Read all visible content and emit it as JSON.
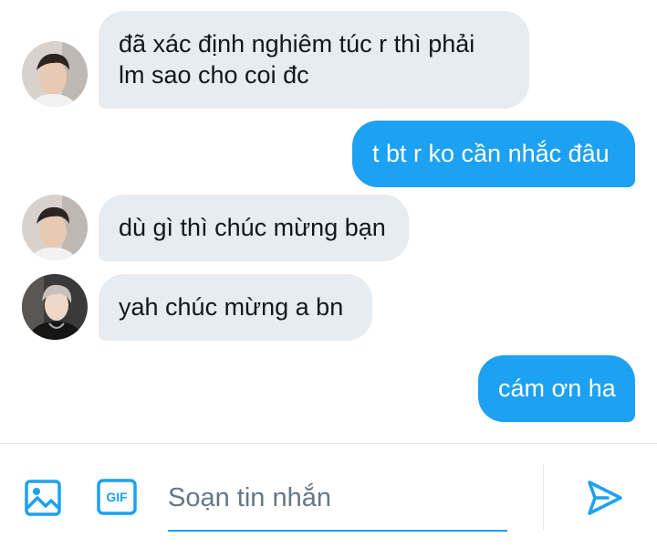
{
  "messages": [
    {
      "from": "other",
      "avatar": "avatar-1",
      "text_lines": [
        "đã xác định nghiêm túc r thì phải",
        "lm sao cho coi đc"
      ]
    },
    {
      "from": "me",
      "text_lines": [
        "t bt r ko cần nhắc đâu"
      ]
    },
    {
      "from": "other",
      "avatar": "avatar-1",
      "text_lines": [
        "dù gì thì chúc mừng bạn"
      ]
    },
    {
      "from": "other",
      "avatar": "avatar-2",
      "text_lines": [
        "yah chúc mừng a bn"
      ]
    },
    {
      "from": "me",
      "text_lines": [
        "cám ơn ha"
      ]
    }
  ],
  "composer": {
    "placeholder": "Soạn tin nhắn",
    "value": "",
    "gif_label": "GIF",
    "image_icon": "image-icon",
    "send_icon": "send-icon"
  },
  "colors": {
    "accent": "#1da1f2",
    "received_bubble": "#e6ecf0",
    "text": "#14171a",
    "placeholder": "#657786"
  }
}
